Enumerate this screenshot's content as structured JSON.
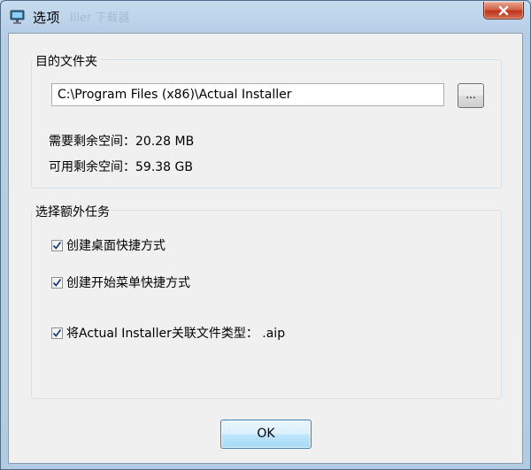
{
  "window": {
    "title": "选项",
    "title_ghost": "Iller 下载器"
  },
  "destination": {
    "group_label": "目的文件夹",
    "path_value": "C:\\Program Files (x86)\\Actual Installer",
    "browse_label": "...",
    "space_required": "需要剩余空间：20.28 MB",
    "space_available": "可用剩余空间：59.38 GB"
  },
  "tasks": {
    "group_label": "选择额外任务",
    "items": [
      {
        "label": "创建桌面快捷方式",
        "checked": true
      },
      {
        "label": "创建开始菜单快捷方式",
        "checked": true
      },
      {
        "label": "将Actual Installer关联文件类型： .aip",
        "checked": true
      }
    ]
  },
  "footer": {
    "ok_label": "OK"
  },
  "icons": {
    "app": "monitor-icon",
    "close": "close-icon",
    "check": "checkmark-icon"
  },
  "colors": {
    "ok_border": "#3c7fb1",
    "close_red": "#c1351c",
    "check_blue": "#1c3a8c"
  }
}
